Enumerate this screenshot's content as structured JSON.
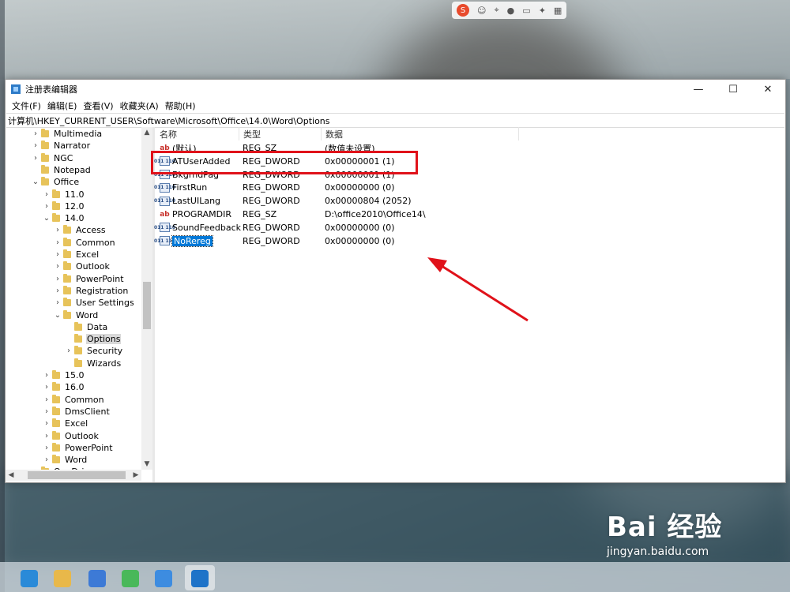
{
  "window": {
    "title": "注册表编辑器",
    "minimize": "—",
    "maximize": "☐",
    "close": "✕"
  },
  "menu": [
    "文件(F)",
    "编辑(E)",
    "查看(V)",
    "收藏夹(A)",
    "帮助(H)"
  ],
  "address": "计算机\\HKEY_CURRENT_USER\\Software\\Microsoft\\Office\\14.0\\Word\\Options",
  "tree": [
    {
      "label": "Multimedia",
      "level": 0,
      "expander": "collapsed"
    },
    {
      "label": "Narrator",
      "level": 0,
      "expander": "collapsed"
    },
    {
      "label": "NGC",
      "level": 0,
      "expander": "collapsed"
    },
    {
      "label": "Notepad",
      "level": 0,
      "expander": "none"
    },
    {
      "label": "Office",
      "level": 0,
      "expander": "expanded"
    },
    {
      "label": "11.0",
      "level": 1,
      "expander": "collapsed"
    },
    {
      "label": "12.0",
      "level": 1,
      "expander": "collapsed"
    },
    {
      "label": "14.0",
      "level": 1,
      "expander": "expanded"
    },
    {
      "label": "Access",
      "level": 2,
      "expander": "collapsed"
    },
    {
      "label": "Common",
      "level": 2,
      "expander": "collapsed"
    },
    {
      "label": "Excel",
      "level": 2,
      "expander": "collapsed"
    },
    {
      "label": "Outlook",
      "level": 2,
      "expander": "collapsed"
    },
    {
      "label": "PowerPoint",
      "level": 2,
      "expander": "collapsed"
    },
    {
      "label": "Registration",
      "level": 2,
      "expander": "collapsed"
    },
    {
      "label": "User Settings",
      "level": 2,
      "expander": "collapsed"
    },
    {
      "label": "Word",
      "level": 2,
      "expander": "expanded"
    },
    {
      "label": "Data",
      "level": 3,
      "expander": "none"
    },
    {
      "label": "Options",
      "level": 3,
      "expander": "none",
      "selected": true
    },
    {
      "label": "Security",
      "level": 3,
      "expander": "collapsed"
    },
    {
      "label": "Wizards",
      "level": 3,
      "expander": "none"
    },
    {
      "label": "15.0",
      "level": 1,
      "expander": "collapsed"
    },
    {
      "label": "16.0",
      "level": 1,
      "expander": "collapsed"
    },
    {
      "label": "Common",
      "level": 1,
      "expander": "collapsed"
    },
    {
      "label": "DmsClient",
      "level": 1,
      "expander": "collapsed"
    },
    {
      "label": "Excel",
      "level": 1,
      "expander": "collapsed"
    },
    {
      "label": "Outlook",
      "level": 1,
      "expander": "collapsed"
    },
    {
      "label": "PowerPoint",
      "level": 1,
      "expander": "collapsed"
    },
    {
      "label": "Word",
      "level": 1,
      "expander": "collapsed"
    },
    {
      "label": "OneDrive",
      "level": 0,
      "expander": "collapsed"
    }
  ],
  "columns": {
    "name": "名称",
    "type": "类型",
    "data": "数据"
  },
  "values": [
    {
      "name": "(默认)",
      "type": "REG_SZ",
      "data": "(数值未设置)",
      "icon": "string-value-icon"
    },
    {
      "name": "ATUserAdded",
      "type": "REG_DWORD",
      "data": "0x00000001 (1)",
      "icon": "dword-value-icon"
    },
    {
      "name": "BkgrndPag",
      "type": "REG_DWORD",
      "data": "0x00000001 (1)",
      "icon": "dword-value-icon"
    },
    {
      "name": "FirstRun",
      "type": "REG_DWORD",
      "data": "0x00000000 (0)",
      "icon": "dword-value-icon"
    },
    {
      "name": "LastUILang",
      "type": "REG_DWORD",
      "data": "0x00000804 (2052)",
      "icon": "dword-value-icon"
    },
    {
      "name": "PROGRAMDIR",
      "type": "REG_SZ",
      "data": "D:\\office2010\\Office14\\",
      "icon": "string-value-icon"
    },
    {
      "name": "SoundFeedback",
      "type": "REG_DWORD",
      "data": "0x00000000 (0)",
      "icon": "dword-value-icon"
    },
    {
      "name": "NoRereg",
      "type": "REG_DWORD",
      "data": "0x00000000 (0)",
      "icon": "dword-value-icon",
      "selected": true
    }
  ],
  "icons": {
    "string": "ab",
    "dword": "011 110",
    "expanded": "⌄",
    "collapsed": "›",
    "scroll_up": "▲",
    "scroll_down": "▼",
    "scroll_left": "◀",
    "scroll_right": "▶"
  },
  "annotation_color": "#e0121a",
  "watermark": {
    "brand": "Bai 经验",
    "url": "jingyan.baidu.com"
  }
}
